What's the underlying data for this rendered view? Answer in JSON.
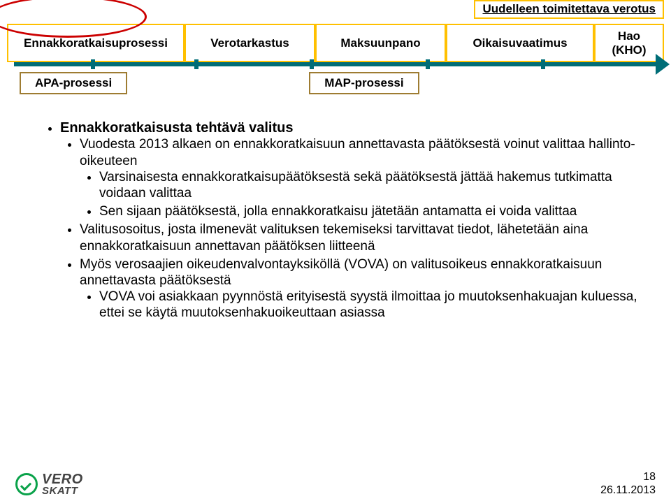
{
  "header": {
    "retitle": "Uudelleen toimitettava verotus",
    "stages": [
      "Ennakkoratkaisuprosessi",
      "Verotarkastus",
      "Maksuunpano",
      "Oikaisuvaatimus",
      "Hao\n(KHO)"
    ],
    "sub": {
      "apa": "APA-prosessi",
      "map": "MAP-prosessi"
    }
  },
  "content": {
    "title": "Ennakkoratkaisusta tehtävä valitus",
    "bullets": [
      {
        "text": "Vuodesta 2013 alkaen on ennakkoratkaisuun annettavasta päätöksestä voinut valittaa hallinto-oikeuteen",
        "children": [
          {
            "text": "Varsinaisesta ennakkoratkaisupäätöksestä sekä päätöksestä jättää hakemus tutkimatta voidaan valittaa"
          },
          {
            "text": "Sen sijaan päätöksestä, jolla ennakkoratkaisu jätetään antamatta ei voida valittaa"
          }
        ]
      },
      {
        "text": "Valitusosoitus, josta ilmenevät valituksen tekemiseksi tarvittavat tiedot, lähetetään aina ennakkoratkaisuun annettavan päätöksen liitteenä"
      },
      {
        "text": "Myös verosaajien oikeudenvalvontayksiköllä (VOVA) on valitusoikeus ennakkoratkaisuun annettavasta päätöksestä",
        "children": [
          {
            "text": "VOVA voi asiakkaan pyynnöstä erityisestä syystä ilmoittaa jo muutoksenhakuajan kuluessa, ettei se käytä muutoksenhakuoikeuttaan asiassa"
          }
        ]
      }
    ]
  },
  "footer": {
    "logo_brand_1": "VERO",
    "logo_brand_2": "SKATT",
    "page": "18",
    "date": "26.11.2013"
  }
}
